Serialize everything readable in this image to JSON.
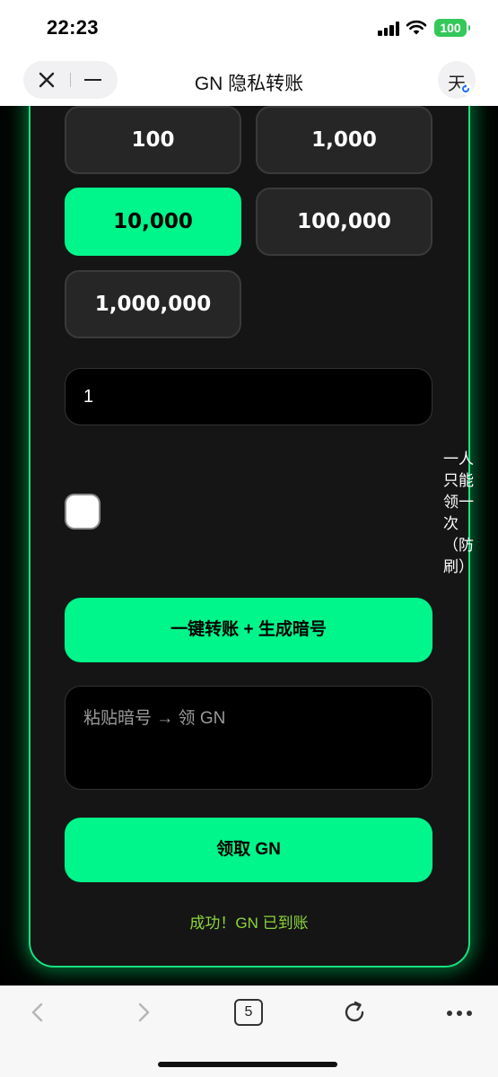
{
  "status_bar": {
    "time": "22:23",
    "battery": "100",
    "battery_color": "#34c759"
  },
  "nav": {
    "title": "GN 隐私转账",
    "translate_label": "天",
    "close_icon": "close-icon",
    "minimize_icon": "minimize-icon"
  },
  "amounts": {
    "options": [
      "100",
      "1,000",
      "10,000",
      "100,000",
      "1,000,000"
    ],
    "selected": "10,000"
  },
  "form": {
    "amount_value": "1",
    "side_note": "一人只能领一次（防刷）",
    "checkbox_checked": false,
    "transfer_button": "一键转账 + 生成暗号",
    "code_placeholder": "粘贴暗号 → 领 GN",
    "claim_button": "领取 GN",
    "status_message": "成功！GN 已到账"
  },
  "toolbar": {
    "tab_count": "5"
  },
  "colors": {
    "accent": "#00f58a",
    "card_border": "#19e07e",
    "success_text": "#8bd53a",
    "card_bg": "#151515"
  }
}
